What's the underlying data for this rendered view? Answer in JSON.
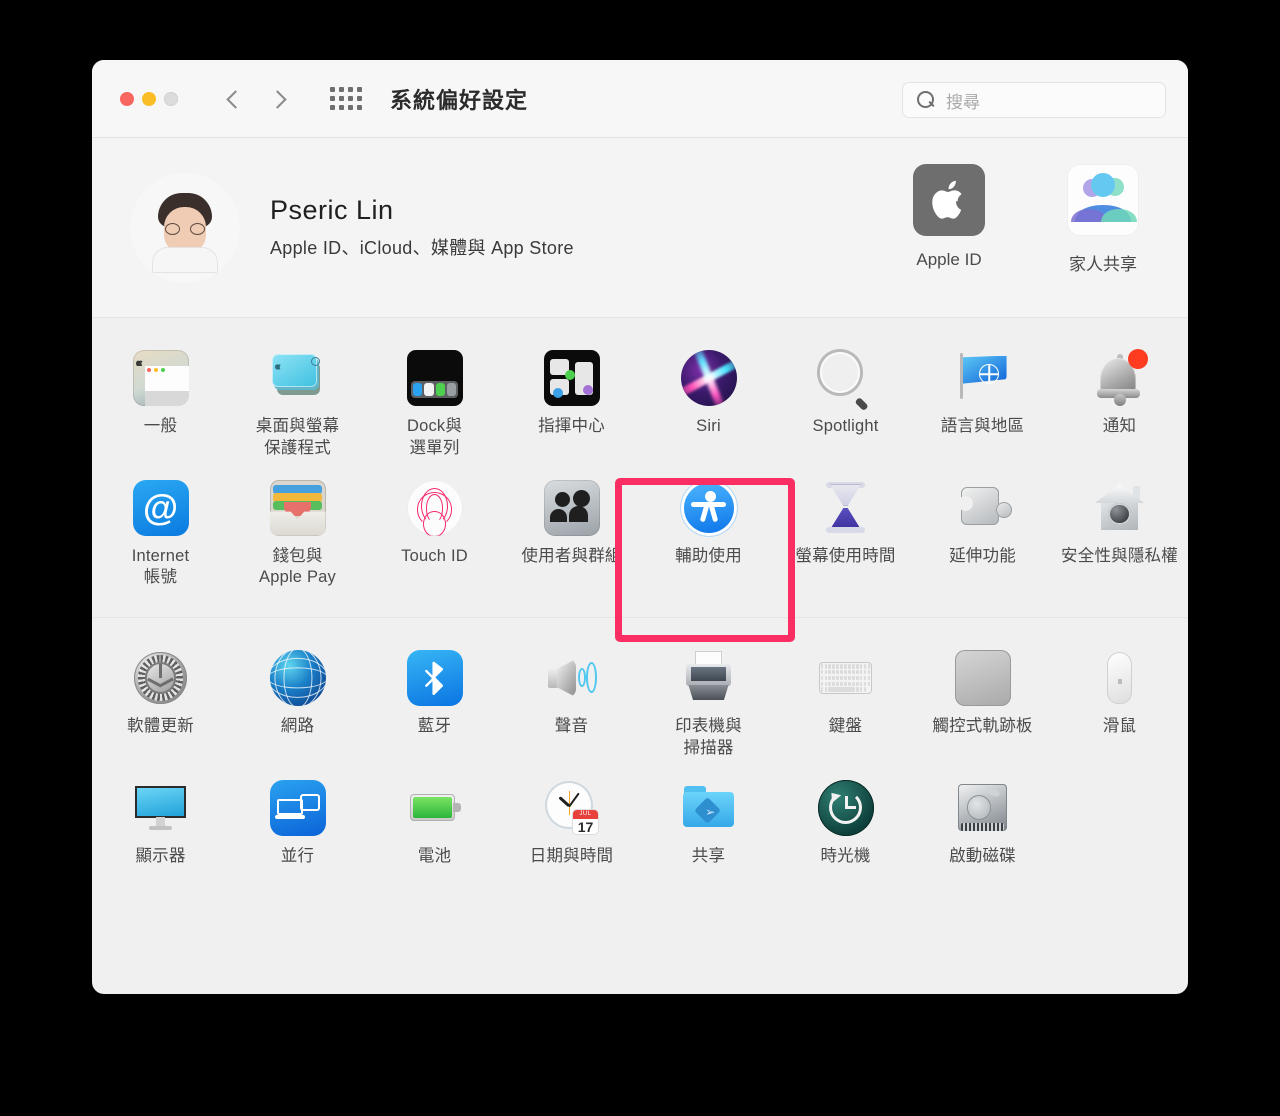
{
  "window": {
    "title": "系統偏好設定",
    "traffic_lights": [
      "close",
      "minimize",
      "zoom"
    ],
    "nav": {
      "back": "back-chevron",
      "forward": "forward-chevron",
      "grid": "show-all-grid"
    }
  },
  "search": {
    "placeholder": "搜尋",
    "value": "",
    "icon": "search-icon"
  },
  "account": {
    "name": "Pseric Lin",
    "subtitle": "Apple ID、iCloud、媒體與 App Store",
    "avatar": "user-avatar",
    "tiles": [
      {
        "label": "Apple ID",
        "icon": "apple-logo-icon"
      },
      {
        "label": "家人共享",
        "icon": "family-sharing-icon"
      }
    ]
  },
  "highlight": {
    "target": "輔助使用",
    "color": "#fb2e63"
  },
  "sections": [
    {
      "name": "personal",
      "items": [
        {
          "label": "一般",
          "icon": "general-icon"
        },
        {
          "label": "桌面與螢幕\n保護程式",
          "icon": "desktop-screensaver-icon"
        },
        {
          "label": "Dock與\n選單列",
          "icon": "dock-menubar-icon"
        },
        {
          "label": "指揮中心",
          "icon": "mission-control-icon"
        },
        {
          "label": "Siri",
          "icon": "siri-icon"
        },
        {
          "label": "Spotlight",
          "icon": "spotlight-icon"
        },
        {
          "label": "語言與地區",
          "icon": "language-region-icon"
        },
        {
          "label": "通知",
          "icon": "notifications-icon",
          "badge": true
        },
        {
          "label": "Internet\n帳號",
          "icon": "internet-accounts-icon"
        },
        {
          "label": "錢包與\nApple Pay",
          "icon": "wallet-applepay-icon"
        },
        {
          "label": "Touch ID",
          "icon": "touch-id-icon"
        },
        {
          "label": "使用者與群組",
          "icon": "users-groups-icon"
        },
        {
          "label": "輔助使用",
          "icon": "accessibility-icon",
          "highlighted": true
        },
        {
          "label": "螢幕使用時間",
          "icon": "screen-time-icon"
        },
        {
          "label": "延伸功能",
          "icon": "extensions-icon"
        },
        {
          "label": "安全性與隱私權",
          "icon": "security-privacy-icon"
        }
      ]
    },
    {
      "name": "hardware",
      "items": [
        {
          "label": "軟體更新",
          "icon": "software-update-icon"
        },
        {
          "label": "網路",
          "icon": "network-icon"
        },
        {
          "label": "藍牙",
          "icon": "bluetooth-icon"
        },
        {
          "label": "聲音",
          "icon": "sound-icon"
        },
        {
          "label": "印表機與\n掃描器",
          "icon": "printers-scanners-icon"
        },
        {
          "label": "鍵盤",
          "icon": "keyboard-icon"
        },
        {
          "label": "觸控式軌跡板",
          "icon": "trackpad-icon"
        },
        {
          "label": "滑鼠",
          "icon": "mouse-icon"
        },
        {
          "label": "顯示器",
          "icon": "displays-icon"
        },
        {
          "label": "並行",
          "icon": "sidecar-icon"
        },
        {
          "label": "電池",
          "icon": "battery-icon"
        },
        {
          "label": "日期與時間",
          "icon": "date-time-icon",
          "cal_month": "JUL",
          "cal_day": "17"
        },
        {
          "label": "共享",
          "icon": "sharing-icon"
        },
        {
          "label": "時光機",
          "icon": "time-machine-icon"
        },
        {
          "label": "啟動磁碟",
          "icon": "startup-disk-icon"
        }
      ]
    }
  ]
}
